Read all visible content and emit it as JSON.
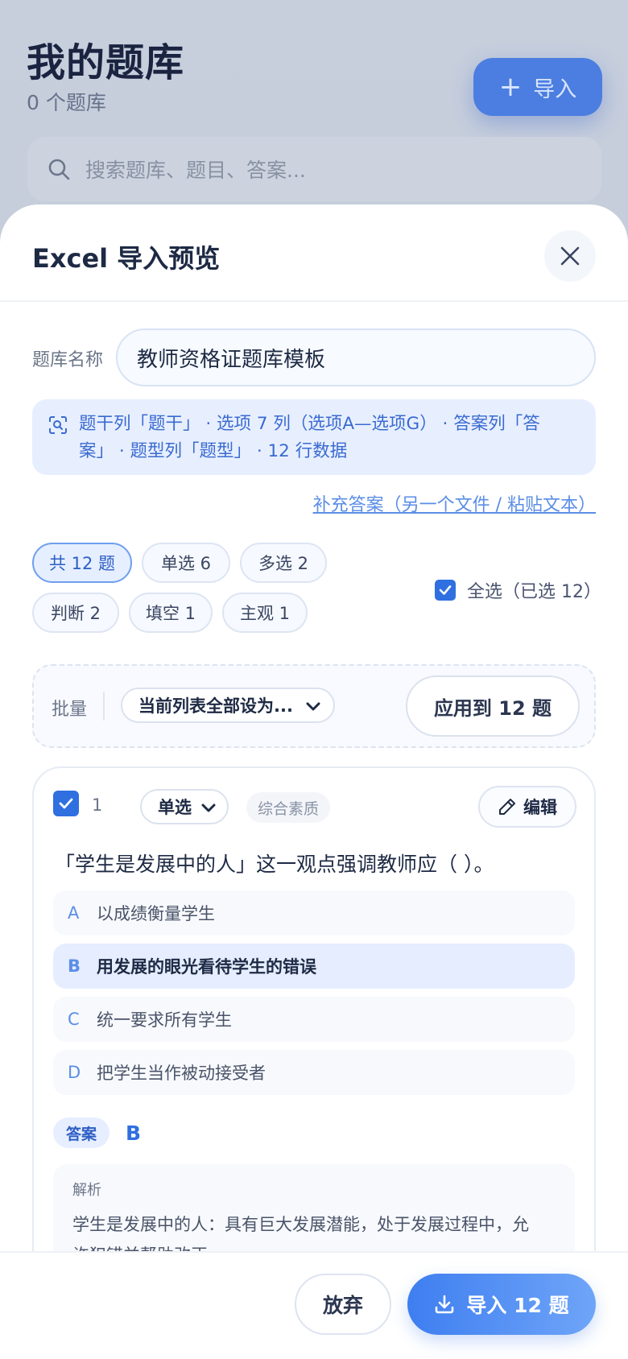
{
  "background": {
    "title": "我的题库",
    "count": "0 个题库",
    "import_label": "导入",
    "search_placeholder": "搜索题库、题目、答案..."
  },
  "sheet": {
    "title": "Excel 导入预览",
    "name_label": "题库名称",
    "name_value": "教师资格证题库模板",
    "info_line1": "题干列「题干」 · 选项 7 列（选项A—选项G） · 答案列「答",
    "info_line2": "案」 · 题型列「题型」 · 12 行数据",
    "supplement_link": "补充答案（另一个文件 / 粘贴文本）",
    "chips": [
      "共 12 题",
      "单选 6",
      "多选 2",
      "判断 2",
      "填空 1",
      "主观 1"
    ],
    "select_all_label": "全选（已选 12）",
    "batch_label": "批量",
    "batch_select": "当前列表全部设为...",
    "apply_label": "应用到 12 题"
  },
  "question": {
    "number": "1",
    "type": "单选",
    "tag": "综合素质",
    "edit_label": "编辑",
    "stem": "「学生是发展中的人」这一观点强调教师应（ ）。",
    "options": [
      {
        "letter": "A",
        "text": "以成绩衡量学生"
      },
      {
        "letter": "B",
        "text": "用发展的眼光看待学生的错误"
      },
      {
        "letter": "C",
        "text": "统一要求所有学生"
      },
      {
        "letter": "D",
        "text": "把学生当作被动接受者"
      }
    ],
    "answer_label": "答案",
    "answer_value": "B",
    "explain_label": "解析",
    "explain_line1": "学生是发展中的人：具有巨大发展潜能，处于发展过程中，允",
    "explain_line2": "许犯错并帮助改正。"
  },
  "footer": {
    "discard_label": "放弃",
    "import_label": "导入 12 题"
  },
  "colors": {
    "accent": "#2f6fe0",
    "accent_light": "#e6eeff",
    "text_dark": "#1e2a44"
  }
}
